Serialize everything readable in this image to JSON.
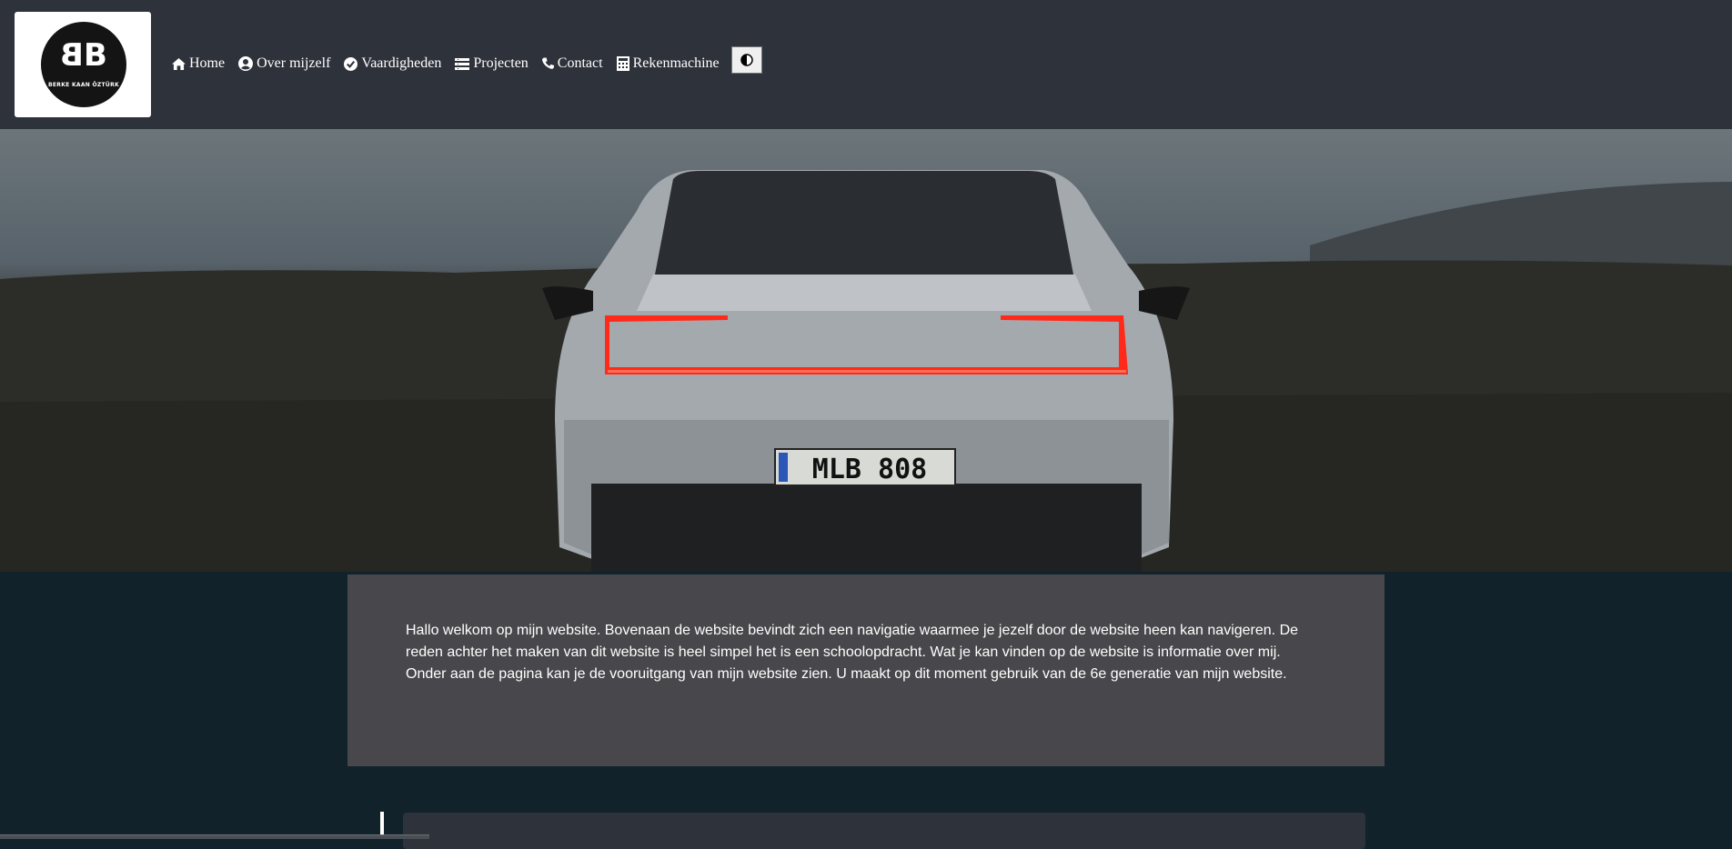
{
  "header": {
    "logo": {
      "monogram": "BB",
      "name": "BERKE KAAN ÖZTÜRK"
    },
    "nav": [
      {
        "label": "Home",
        "icon": "home-icon"
      },
      {
        "label": "Over mijzelf",
        "icon": "user-circle-icon"
      },
      {
        "label": "Vaardigheden",
        "icon": "check-circle-icon"
      },
      {
        "label": "Projecten",
        "icon": "list-icon"
      },
      {
        "label": "Contact",
        "icon": "phone-icon"
      },
      {
        "label": "Rekenmachine",
        "icon": "calculator-icon"
      }
    ],
    "theme_toggle_icon": "contrast-icon"
  },
  "hero": {
    "license_plate": "MLB 808"
  },
  "intro": {
    "text": "Hallo welkom op mijn website. Bovenaan de website bevindt zich een navigatie waarmee je jezelf door de website heen kan navigeren. De reden achter het maken van dit website is heel simpel het is een schoolopdracht. Wat je kan vinden op de website is informatie over mij. Onder aan de pagina kan je de vooruitgang van mijn website zien. U maakt op dit moment gebruik van de 6e generatie van mijn website."
  },
  "colors": {
    "header_bg": "#2e323b",
    "page_bg": "#11222a",
    "intro_bg": "#48484c",
    "tail_light": "#ff2a1a"
  }
}
